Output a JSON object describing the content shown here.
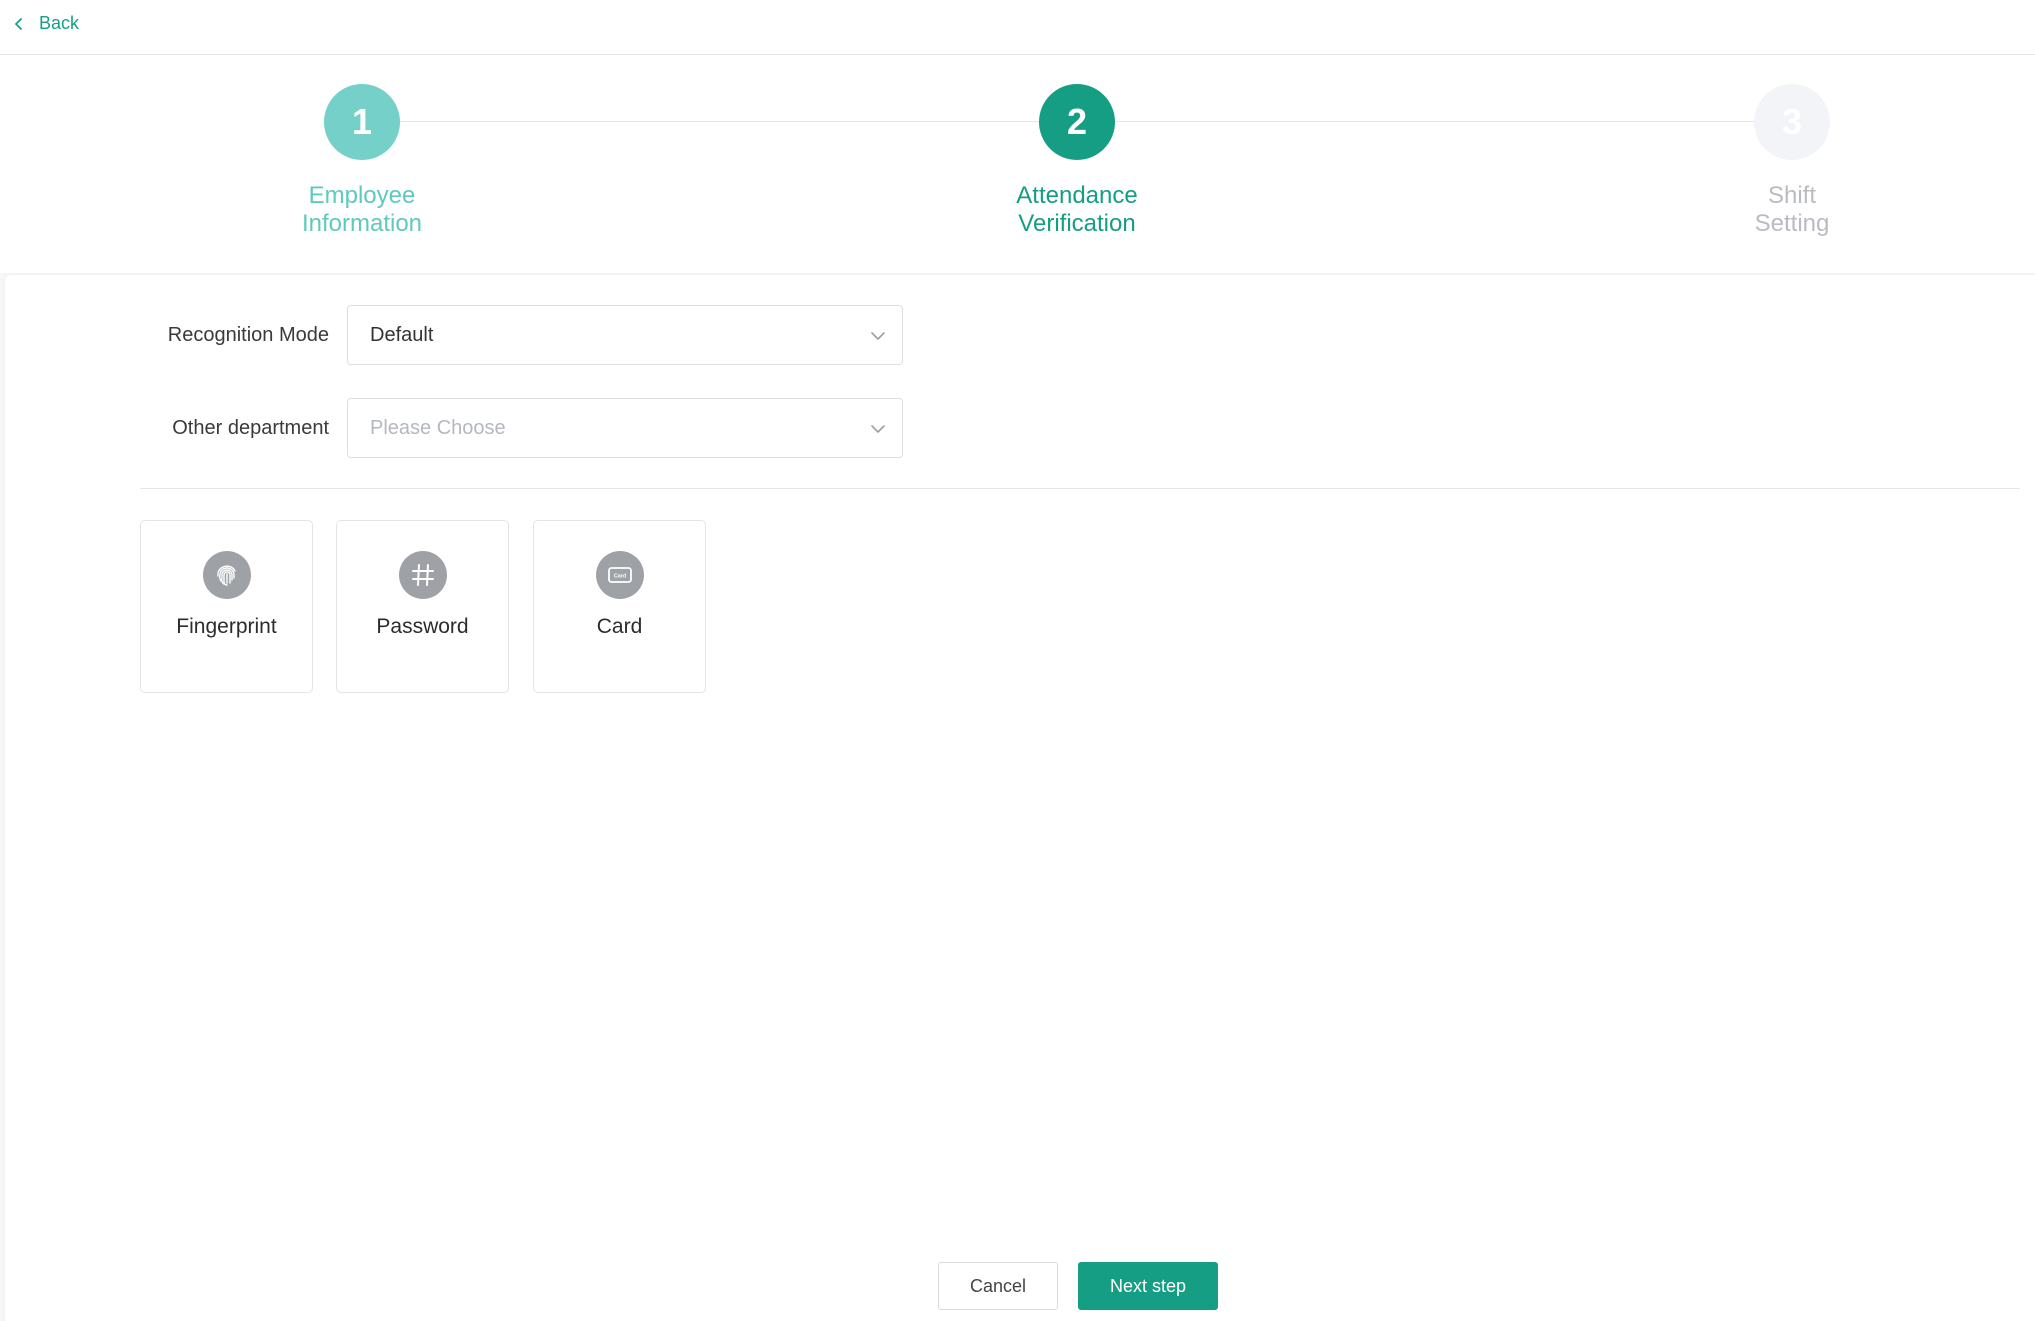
{
  "header": {
    "back_label": "Back"
  },
  "steps": [
    {
      "number": "1",
      "label_line1": "Employee",
      "label_line2": "Information",
      "state": "done"
    },
    {
      "number": "2",
      "label_line1": "Attendance",
      "label_line2": "Verification",
      "state": "active"
    },
    {
      "number": "3",
      "label_line1": "Shift",
      "label_line2": "Setting",
      "state": "pending"
    }
  ],
  "form": {
    "recognition_mode": {
      "label": "Recognition Mode",
      "value": "Default"
    },
    "other_department": {
      "label": "Other department",
      "placeholder": "Please Choose"
    }
  },
  "methods": [
    {
      "label": "Fingerprint",
      "icon": "fingerprint-icon"
    },
    {
      "label": "Password",
      "icon": "hash-icon"
    },
    {
      "label": "Card",
      "icon": "card-icon",
      "icon_text": "Card"
    }
  ],
  "footer": {
    "cancel_label": "Cancel",
    "next_label": "Next step"
  },
  "colors": {
    "accent": "#169e85",
    "step_done": "#74d0c8",
    "step_pending": "#f2f4f7",
    "icon_bg": "#9ea1a5"
  }
}
